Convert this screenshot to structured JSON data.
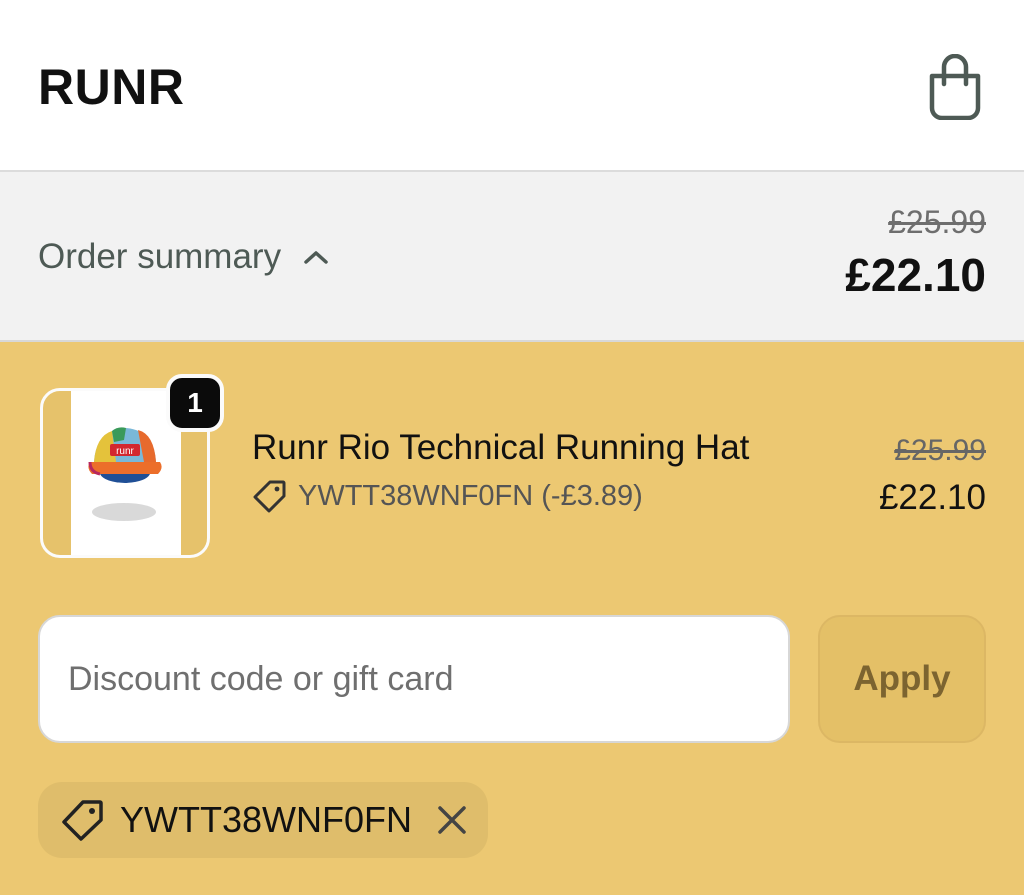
{
  "header": {
    "brand": "RUNR",
    "cart_icon": "shopping-bag-icon"
  },
  "summary": {
    "label": "Order summary",
    "toggle_icon": "chevron-up-icon",
    "original_total": "£25.99",
    "total": "£22.10"
  },
  "line_item": {
    "quantity": "1",
    "name": "Runr Rio Technical Running Hat",
    "discount_icon": "tag-icon",
    "discount_text": "YWTT38WNF0FN (-£3.89)",
    "original_price": "£25.99",
    "price": "£22.10",
    "image_text": "runr"
  },
  "discount_form": {
    "placeholder": "Discount code or gift card",
    "value": "",
    "apply_label": "Apply"
  },
  "applied_code": {
    "icon": "tag-icon",
    "code": "YWTT38WNF0FN",
    "remove_icon": "close-icon"
  },
  "colors": {
    "accent_background": "#ecc872",
    "summary_background": "#f2f2f2",
    "badge": "#0b0b0b",
    "icon_stroke": "#4e5a55"
  }
}
